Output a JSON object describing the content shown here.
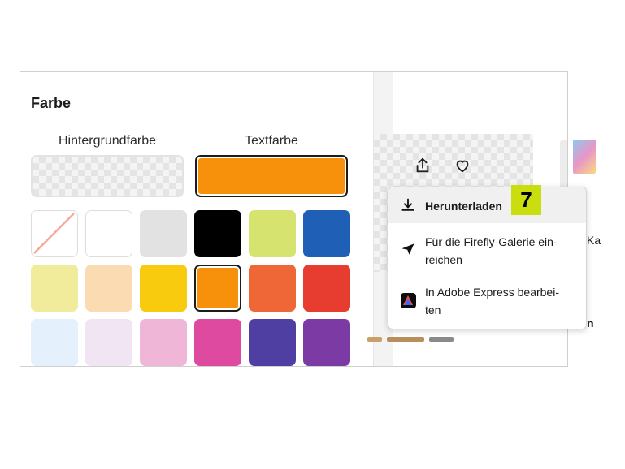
{
  "panel": {
    "title": "Farbe",
    "background_label": "Hintergrundfarbe",
    "text_label": "Textfarbe",
    "background_value": "transparent",
    "text_value": "#f7900a"
  },
  "swatches": [
    {
      "name": "none",
      "color": "none"
    },
    {
      "name": "white",
      "color": "#ffffff"
    },
    {
      "name": "light-gray",
      "color": "#e2e2e2"
    },
    {
      "name": "black",
      "color": "#000000"
    },
    {
      "name": "lime",
      "color": "#d6e36e"
    },
    {
      "name": "blue",
      "color": "#1f5fb6"
    },
    {
      "name": "light-yellow",
      "color": "#f1ec9b"
    },
    {
      "name": "peach",
      "color": "#fbdcb2"
    },
    {
      "name": "yellow",
      "color": "#f8cb0f"
    },
    {
      "name": "orange",
      "color": "#f7900a",
      "selected": true
    },
    {
      "name": "red-orange",
      "color": "#ef6736"
    },
    {
      "name": "red",
      "color": "#e73c30"
    },
    {
      "name": "light-blue",
      "color": "#e4f0fb"
    },
    {
      "name": "lavender",
      "color": "#f1e4f3"
    },
    {
      "name": "pink",
      "color": "#f0b6d8"
    },
    {
      "name": "magenta",
      "color": "#dd4aa0"
    },
    {
      "name": "indigo",
      "color": "#4f3fa3"
    },
    {
      "name": "purple",
      "color": "#7b3aa4"
    }
  ],
  "menu": {
    "download_label": "Herunterladen",
    "submit_line1": "Für die Firefly-Galerie ein-",
    "submit_line2": "reichen",
    "express_line1": "In Adobe Express bearbei-",
    "express_line2": "ten"
  },
  "badge": "7",
  "side_text_ka": "Ka",
  "side_text_n": "n",
  "icons": {
    "share": "share-icon",
    "favorite": "heart-icon",
    "download": "download-icon",
    "submit": "paper-plane-icon",
    "express": "adobe-express-icon"
  }
}
